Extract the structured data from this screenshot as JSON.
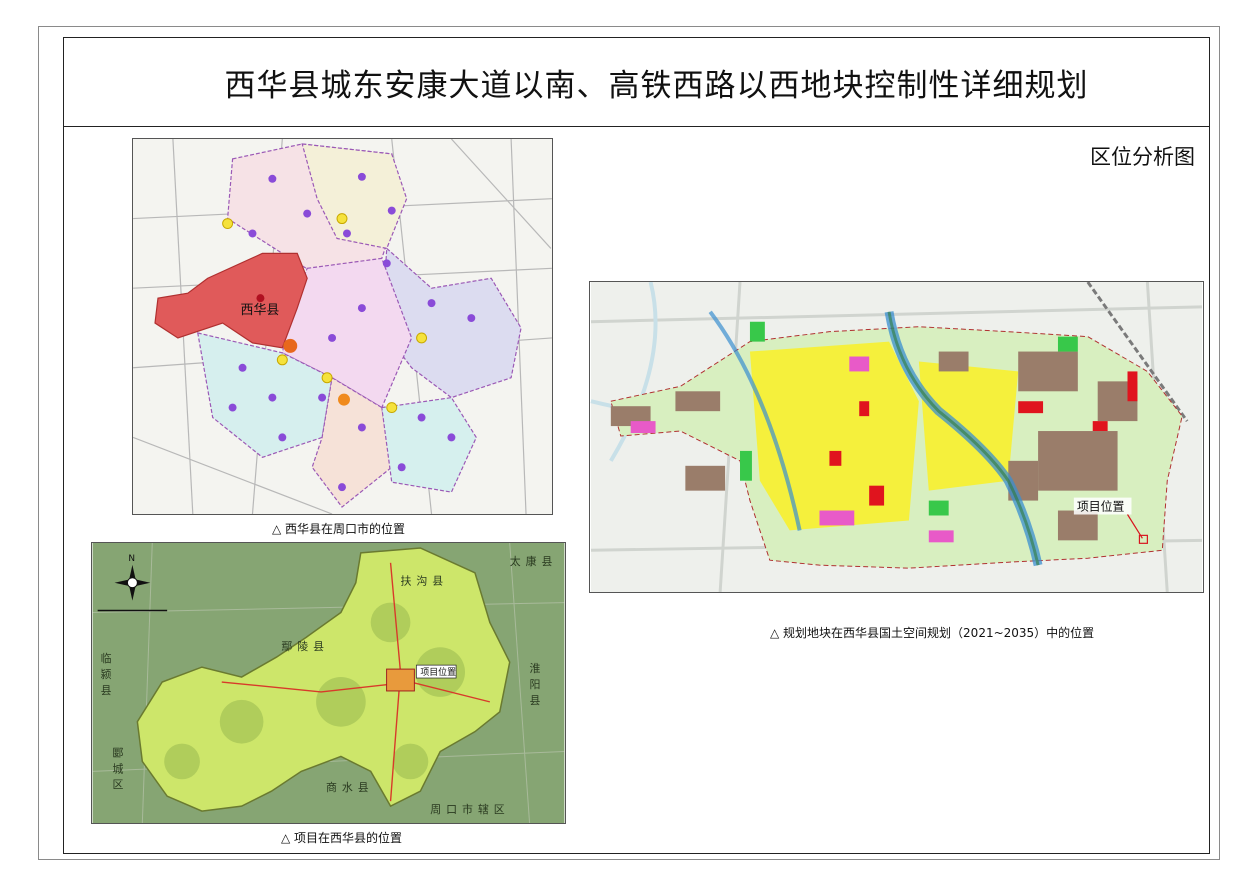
{
  "title": "西华县城东安康大道以南、高铁西路以西地块控制性详细规划",
  "sheet_name": "区位分析图",
  "maps": {
    "zhoukou": {
      "caption": "△  西华县在周口市的位置",
      "county_label": "西华县"
    },
    "xihua": {
      "caption": "△ 项目在西华县的位置",
      "site_label": "项目位置",
      "north_label": "N",
      "neighbors": [
        "扶",
        "沟",
        "县",
        "鄢",
        "陵",
        "县",
        "淮",
        "阳",
        "县",
        "商",
        "水",
        "县",
        "郾",
        "城",
        "区",
        "周",
        "口",
        "市",
        "辖",
        "区",
        "太",
        "康",
        "县",
        "临",
        "颍",
        "县"
      ]
    },
    "landuse": {
      "caption": "△    规划地块在西华县国土空间规划（2021~2035）中的位置",
      "site_label": "项目位置"
    }
  },
  "colors": {
    "frame": "#222222",
    "county_red": "#e05a5a",
    "residential": "#f5f03c",
    "industrial": "#9a7d6a",
    "commercial": "#e0141e",
    "green": "#38c84a",
    "water": "#3a8fd0",
    "public": "#e85ac8"
  }
}
